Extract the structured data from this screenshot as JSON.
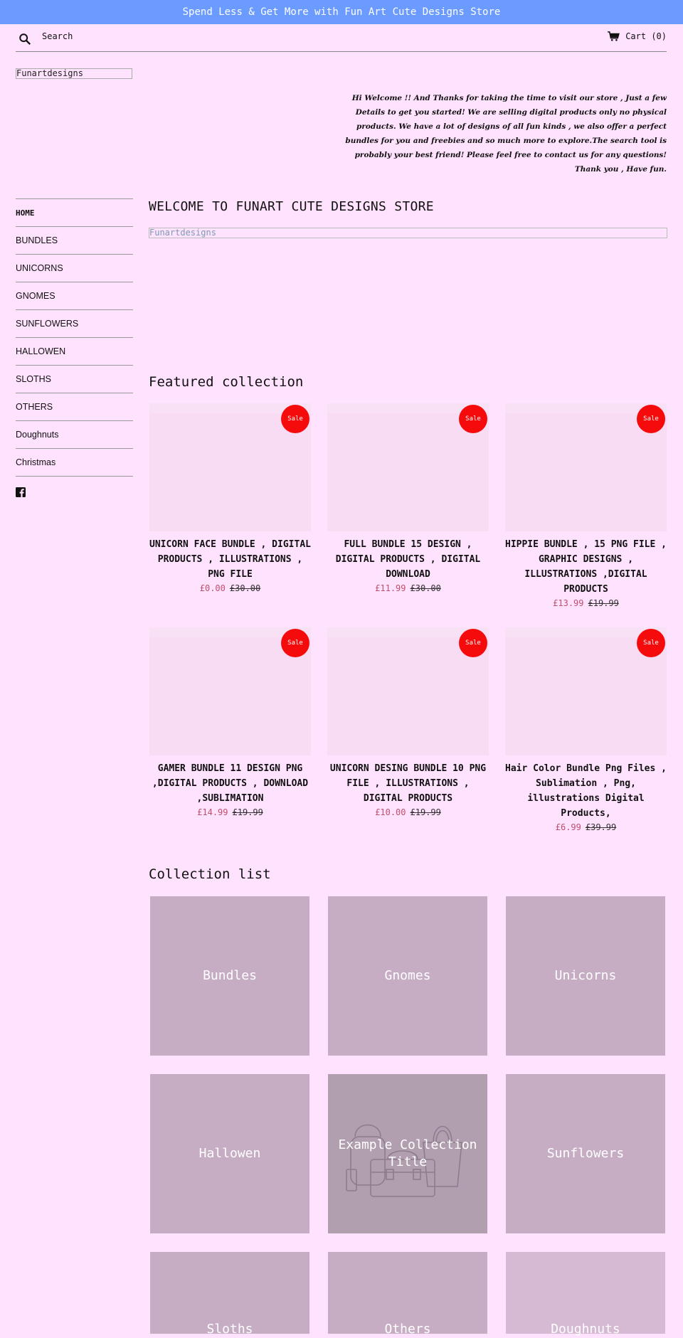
{
  "announcement": "Spend Less & Get More with Fun Art Cute Designs Store",
  "header": {
    "search_label": "Search",
    "cart_label": "Cart (0)"
  },
  "logo_text": "Funartdesigns",
  "welcome_text": "Hi Welcome !! And Thanks for taking the time to visit our store , Just a few Details to get you started! We are selling digital products only no physical products. We have a lot of designs of all fun kinds , we also offer a perfect bundles for you and freebies and so much more to explore.The search tool is probably your best friend! Please feel free to contact us for any questions! Thank you , Have fun.",
  "nav": {
    "items": [
      {
        "label": "HOME"
      },
      {
        "label": "BUNDLES"
      },
      {
        "label": "UNICORNS"
      },
      {
        "label": "GNOMES"
      },
      {
        "label": "SUNFLOWERS"
      },
      {
        "label": "HALLOWEN"
      },
      {
        "label": "SLOTHS"
      },
      {
        "label": "OTHERS"
      },
      {
        "label": "Doughnuts"
      },
      {
        "label": "Christmas"
      }
    ]
  },
  "main": {
    "page_title": "WELCOME TO FUNART CUTE DESIGNS STORE",
    "logo_text": "Funartdesigns",
    "featured_title": "Featured collection",
    "sale_badge": "Sale",
    "products": [
      {
        "title": "UNICORN FACE BUNDLE , DIGITAL PRODUCTS , ILLUSTRATIONS , PNG FILE",
        "price": "£0.00",
        "compare": "£30.00"
      },
      {
        "title": "FULL BUNDLE 15 DESIGN , DIGITAL PRODUCTS , DIGITAL DOWNLOAD",
        "price": "£11.99",
        "compare": "£30.00"
      },
      {
        "title": "HIPPIE BUNDLE , 15 PNG FILE , GRAPHIC DESIGNS , ILLUSTRATIONS ,DIGITAL PRODUCTS",
        "price": "£13.99",
        "compare": "£19.99"
      },
      {
        "title": "GAMER BUNDLE 11 DESIGN PNG ,DIGITAL PRODUCTS , DOWNLOAD ,SUBLIMATION",
        "price": "£14.99",
        "compare": "£19.99"
      },
      {
        "title": "UNICORN DESING BUNDLE 10 PNG FILE , ILLUSTRATIONS , DIGITAL PRODUCTS",
        "price": "£10.00",
        "compare": "£19.99"
      },
      {
        "title": "Hair Color Bundle Png Files , Sublimation , Png, illustrations Digital Products,",
        "price": "£6.99",
        "compare": "£39.99"
      }
    ],
    "collection_title": "Collection list",
    "collections": [
      {
        "label": "Bundles"
      },
      {
        "label": "Gnomes"
      },
      {
        "label": "Unicorns"
      },
      {
        "label": "Hallowen"
      },
      {
        "label": "Example Collection Title"
      },
      {
        "label": "Sunflowers"
      },
      {
        "label": "Sloths"
      },
      {
        "label": "Others"
      },
      {
        "label": "Doughnuts"
      }
    ]
  },
  "colors": {
    "announcement_bg": "#6b9bff",
    "page_bg": "#ffe2fd",
    "sale_badge": "#f50b0b",
    "sale_price": "#c0506c",
    "collection_tile": "#c6adc4"
  }
}
